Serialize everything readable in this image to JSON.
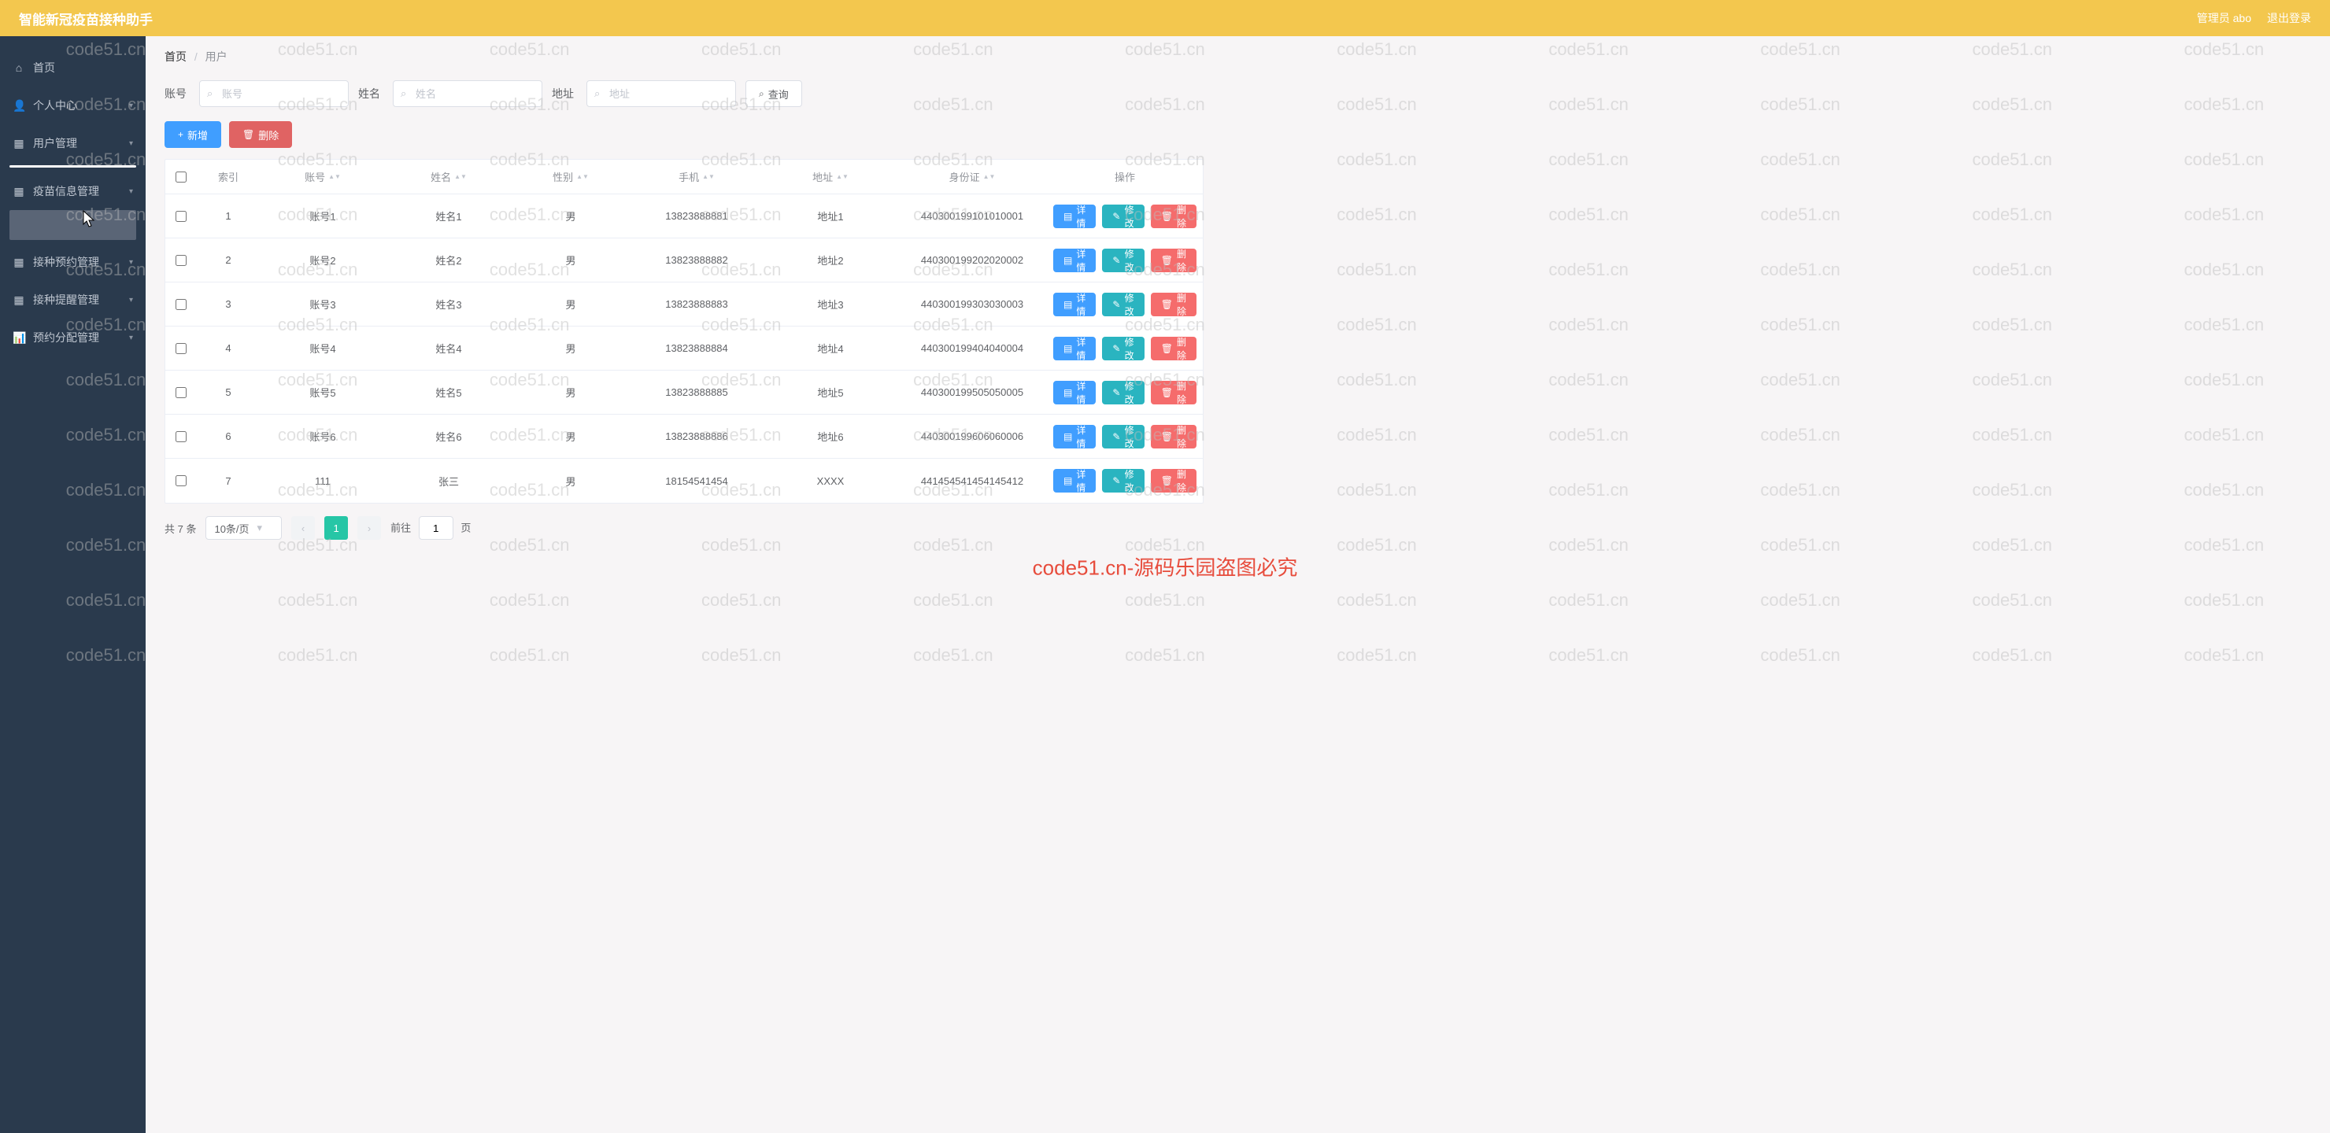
{
  "header": {
    "title": "智能新冠疫苗接种助手",
    "user": "管理员 abo",
    "logout": "退出登录"
  },
  "sidebar": [
    {
      "icon": "⌂",
      "label": "首页",
      "arrow": false
    },
    {
      "icon": "👤",
      "label": "个人中心",
      "arrow": true
    },
    {
      "icon": "▦",
      "label": "用户管理",
      "arrow": true
    },
    {
      "icon": "▦",
      "label": "疫苗信息管理",
      "arrow": true
    },
    {
      "icon": "▦",
      "label": "接种预约管理",
      "arrow": true
    },
    {
      "icon": "▦",
      "label": "接种提醒管理",
      "arrow": true
    },
    {
      "icon": "📊",
      "label": "预约分配管理",
      "arrow": true
    }
  ],
  "breadcrumb": {
    "root": "首页",
    "current": "用户"
  },
  "search": {
    "acc_label": "账号",
    "acc_ph": "账号",
    "name_label": "姓名",
    "name_ph": "姓名",
    "addr_label": "地址",
    "addr_ph": "地址",
    "query": "查询"
  },
  "actions": {
    "add": "新增",
    "del": "删除"
  },
  "columns": {
    "idx": "索引",
    "acc": "账号",
    "name": "姓名",
    "sex": "性别",
    "phone": "手机",
    "addr": "地址",
    "id": "身份证",
    "ops": "操作"
  },
  "row_actions": {
    "detail": "详情",
    "edit": "修改",
    "del": "删除"
  },
  "rows": [
    {
      "idx": "1",
      "acc": "账号1",
      "name": "姓名1",
      "sex": "男",
      "phone": "13823888881",
      "addr": "地址1",
      "id": "440300199101010001"
    },
    {
      "idx": "2",
      "acc": "账号2",
      "name": "姓名2",
      "sex": "男",
      "phone": "13823888882",
      "addr": "地址2",
      "id": "440300199202020002"
    },
    {
      "idx": "3",
      "acc": "账号3",
      "name": "姓名3",
      "sex": "男",
      "phone": "13823888883",
      "addr": "地址3",
      "id": "440300199303030003"
    },
    {
      "idx": "4",
      "acc": "账号4",
      "name": "姓名4",
      "sex": "男",
      "phone": "13823888884",
      "addr": "地址4",
      "id": "440300199404040004"
    },
    {
      "idx": "5",
      "acc": "账号5",
      "name": "姓名5",
      "sex": "男",
      "phone": "13823888885",
      "addr": "地址5",
      "id": "440300199505050005"
    },
    {
      "idx": "6",
      "acc": "账号6",
      "name": "姓名6",
      "sex": "男",
      "phone": "13823888886",
      "addr": "地址6",
      "id": "440300199606060006"
    },
    {
      "idx": "7",
      "acc": "111",
      "name": "张三",
      "sex": "男",
      "phone": "18154541454",
      "addr": "XXXX",
      "id": "441454541454145412"
    }
  ],
  "pagination": {
    "total": "共 7 条",
    "pagesize": "10条/页",
    "page": "1",
    "jump_pre": "前往",
    "jump_val": "1",
    "jump_suf": "页"
  },
  "watermark": {
    "repeat": "code51.cn",
    "center": "code51.cn-源码乐园盗图必究"
  }
}
